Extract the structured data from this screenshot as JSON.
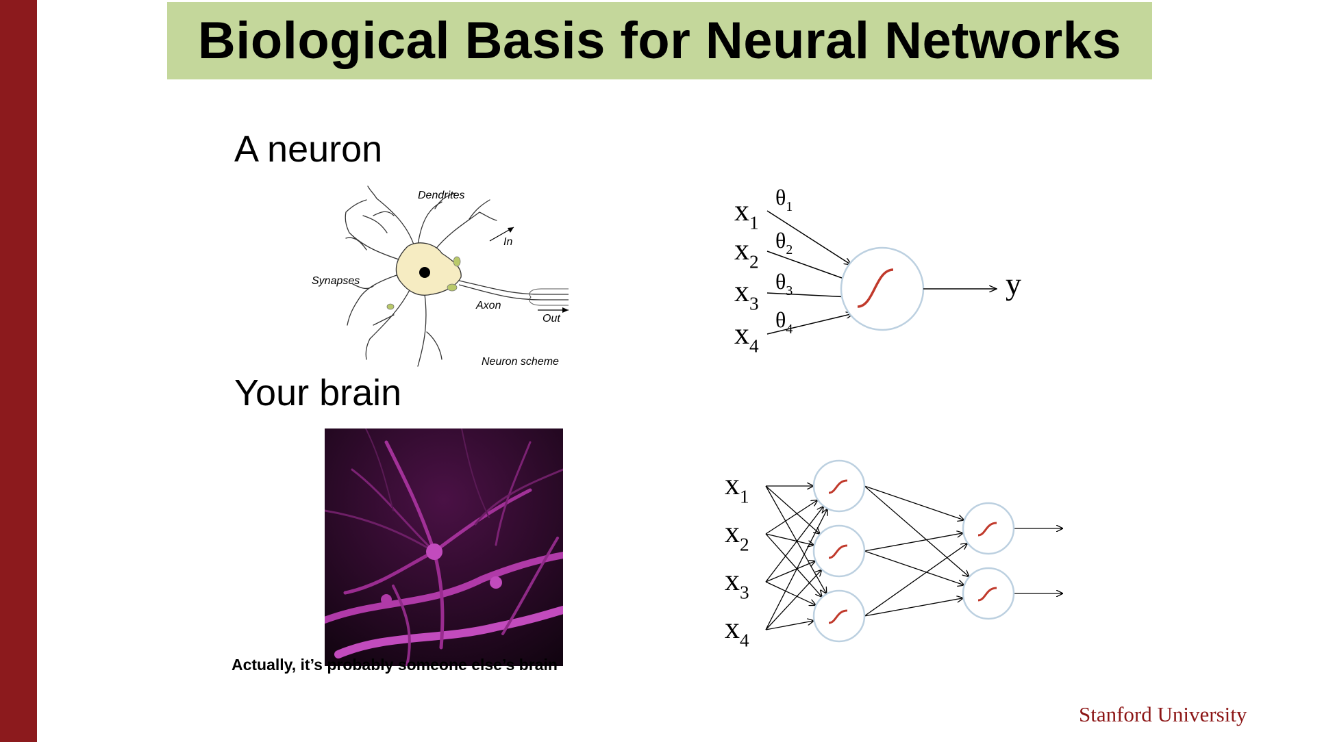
{
  "title": "Biological Basis for Neural Networks",
  "headings": {
    "neuron": "A neuron",
    "brain": "Your brain"
  },
  "neuron_labels": {
    "dendrites": "Dendrites",
    "synapses": "Synapses",
    "axon": "Axon",
    "in": "In",
    "out": "Out",
    "scheme": "Neuron scheme"
  },
  "caption": "Actually, it’s probably someone else’s brain",
  "logo": "Stanford University",
  "single_neuron": {
    "inputs": [
      "x",
      "x",
      "x",
      "x"
    ],
    "input_subscripts": [
      "1",
      "2",
      "3",
      "4"
    ],
    "weights": [
      "θ",
      "θ",
      "θ",
      "θ"
    ],
    "weight_subscripts": [
      "1",
      "2",
      "3",
      "4"
    ],
    "output": "y"
  },
  "network": {
    "inputs": [
      "x",
      "x",
      "x",
      "x"
    ],
    "input_subscripts": [
      "1",
      "2",
      "3",
      "4"
    ],
    "hidden_units": 3,
    "output_units": 2
  },
  "colors": {
    "side_bar": "#8c1a1d",
    "title_bg": "#c4d79b",
    "sigmoid": "#c0392b",
    "node_stroke": "#bcd0e0",
    "logo": "#8c1515"
  }
}
